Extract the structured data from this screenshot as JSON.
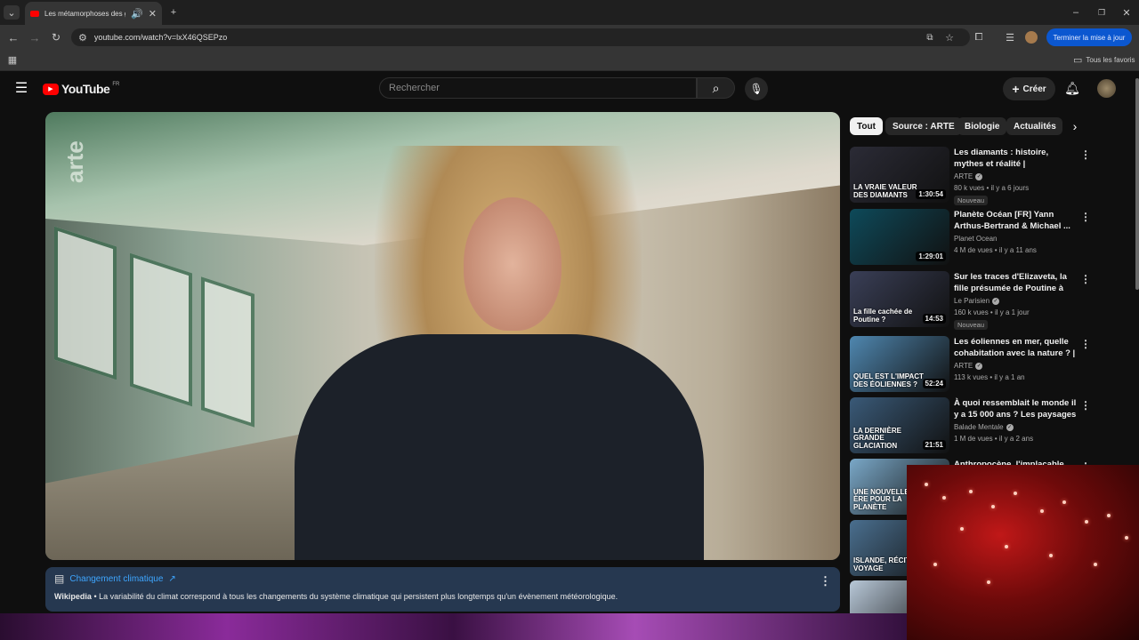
{
  "browser": {
    "tab_title": "Les métamorphoses des gla",
    "url": "youtube.com/watch?v=lxX46QSEPzo",
    "update_button": "Terminer la mise à jour",
    "bookmarks_all": "Tous les favoris"
  },
  "header": {
    "logo": "YouTube",
    "region": "FR",
    "search_placeholder": "Rechercher",
    "create_label": "Créer"
  },
  "video": {
    "channel_watermark": "arte"
  },
  "info_card": {
    "title": "Changement climatique",
    "source": "Wikipedia",
    "text": "La variabilité du climat correspond à tous les changements du système climatique qui persistent plus longtemps qu'un évènement météorologique."
  },
  "chips": [
    "Tout",
    "Source : ARTE",
    "Biologie",
    "Actualités"
  ],
  "related": [
    {
      "title": "Les diamants : histoire, mythes et réalité | Documentaire | ARTE",
      "channel": "ARTE",
      "verified": true,
      "meta": "80 k vues • il y a 6 jours",
      "badge": "Nouveau",
      "duration": "1:30:54",
      "thumb_text": "LA VRAIE VALEUR DES DIAMANTS",
      "color": "#2b2b36"
    },
    {
      "title": "Planète Océan [FR] Yann Arthus-Bertrand & Michael ...",
      "channel": "Planet Ocean",
      "verified": false,
      "meta": "4 M de vues • il y a 11 ans",
      "badge": "",
      "duration": "1:29:01",
      "thumb_text": "",
      "color": "#0e4a5a"
    },
    {
      "title": "Sur les traces d'Elizaveta, la fille présumée de Poutine à Paris",
      "channel": "Le Parisien",
      "verified": true,
      "meta": "160 k vues • il y a 1 jour",
      "badge": "Nouveau",
      "duration": "14:53",
      "thumb_text": "La fille cachée de Poutine ?",
      "color": "#3a3f57"
    },
    {
      "title": "Les éoliennes en mer, quelle cohabitation avec la nature ? | ...",
      "channel": "ARTE",
      "verified": true,
      "meta": "113 k vues • il y a 1 an",
      "badge": "",
      "duration": "52:24",
      "thumb_text": "QUEL EST L'IMPACT DES ÉOLIENNES ?",
      "color": "#4f87b0"
    },
    {
      "title": "À quoi ressemblait le monde il y a 15 000 ans ? Les paysages ...",
      "channel": "Balade Mentale",
      "verified": true,
      "meta": "1 M de vues • il y a 2 ans",
      "badge": "",
      "duration": "21:51",
      "thumb_text": "LA DERNIÈRE GRANDE GLACIATION",
      "color": "#3a5a78"
    },
    {
      "title": "Anthropocène, l'implacable ...",
      "channel": "",
      "verified": false,
      "meta": "",
      "badge": "",
      "duration": "",
      "thumb_text": "UNE NOUVELLE ÈRE POUR LA PLANÈTE",
      "color": "#7aa8c8"
    },
    {
      "title": "",
      "channel": "",
      "verified": false,
      "meta": "",
      "badge": "",
      "duration": "",
      "thumb_text": "ISLANDE, RÉCIT DE VOYAGE",
      "color": "#4a6f8f"
    },
    {
      "title": "",
      "channel": "",
      "verified": false,
      "meta": "",
      "badge": "",
      "duration": "",
      "thumb_text": "",
      "color": "#b8c8d8"
    }
  ]
}
